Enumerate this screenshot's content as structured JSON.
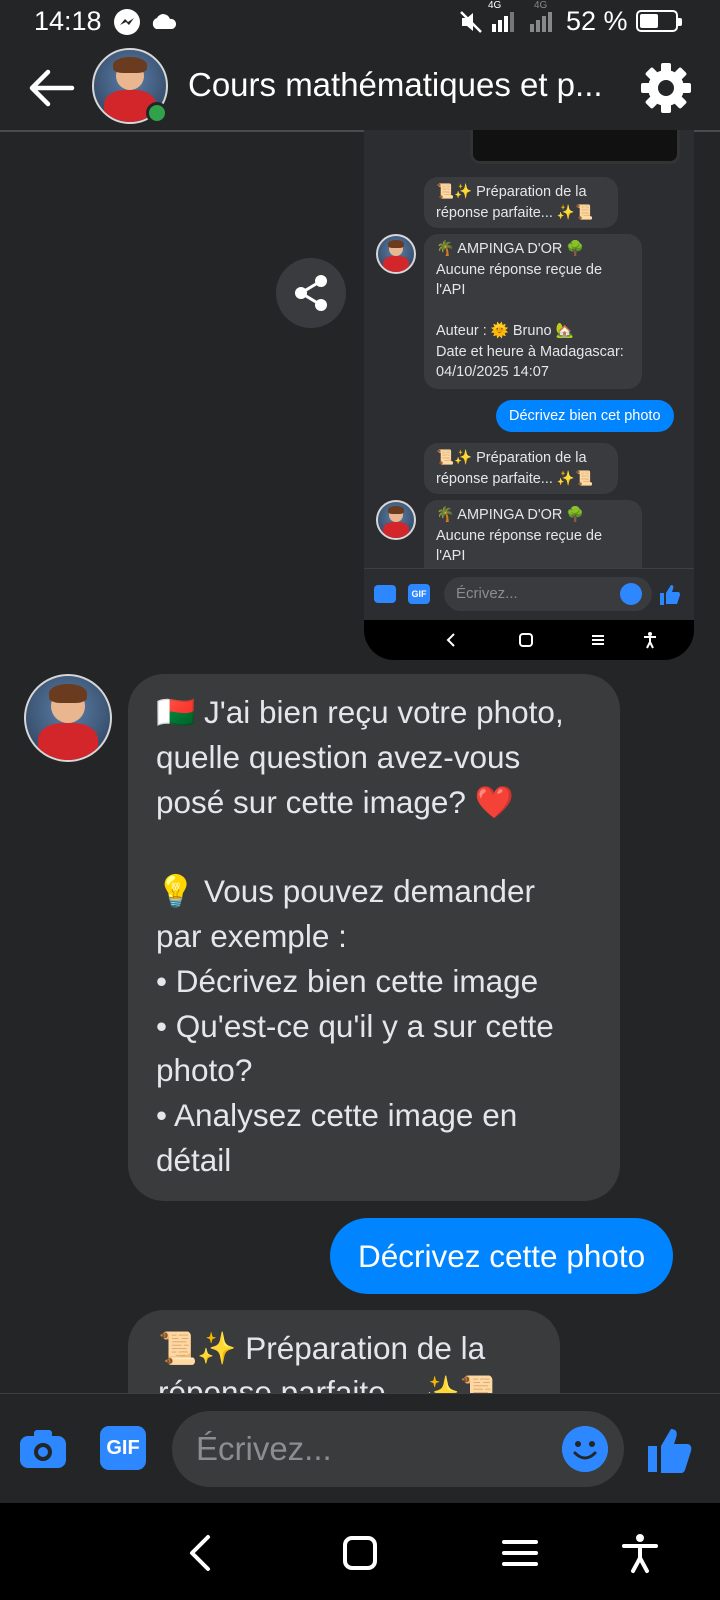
{
  "status_bar": {
    "time": "14:18",
    "network_1": "4G",
    "network_2": "4G",
    "battery_text": "52 %",
    "battery_level": 0.52
  },
  "header": {
    "title": "Cours mathématiques et p..."
  },
  "embedded_screenshot": {
    "bubbles": [
      {
        "text": "📜✨ Préparation de la\nréponse parfaite... ✨📜"
      },
      {
        "text": "🌴 AMPINGA D'OR 🌳\nAucune réponse reçue de\nl'API\n\nAuteur : 🌞 Bruno 🏡\nDate et heure à Madagascar:\n04/10/2025 14:07"
      },
      {
        "text": "📜✨ Préparation de la\nréponse parfaite... ✨📜"
      },
      {
        "text": "🌴 AMPINGA D'OR 🌳\nAucune réponse reçue de\nl'API"
      }
    ],
    "outgoing": "Décrivez bien cet photo",
    "input_placeholder": "Écrivez...",
    "gif_label": "GIF"
  },
  "messages": {
    "bot_reply": "🇲🇬 J'ai bien reçu votre photo,\nquelle question avez-vous\nposé sur cette image? ❤️\n\n💡 Vous pouvez demander\npar exemple :\n• Décrivez bien cette image\n• Qu'est-ce qu'il y a sur cette\nphoto?\n• Analysez cette image en\ndétail",
    "user_message": "Décrivez cette photo",
    "preparing": "📜✨ Préparation de la\nréponse parfaite... ✨📜"
  },
  "composer": {
    "placeholder": "Écrivez...",
    "gif_label": "GIF"
  },
  "colors": {
    "accent": "#0084ff",
    "background": "#242526",
    "bubble": "#3a3b3c",
    "online": "#31a24c"
  }
}
